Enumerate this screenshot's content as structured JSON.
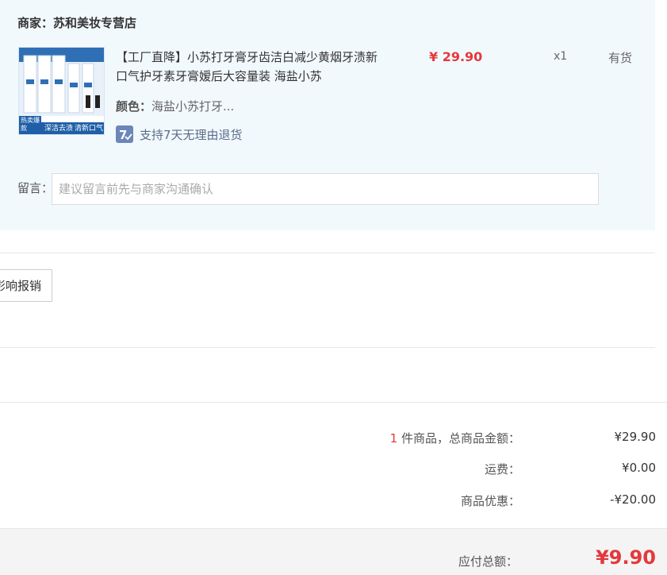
{
  "merchant": {
    "label": "商家：",
    "name": "苏和美妆专营店"
  },
  "product": {
    "title": "【工厂直降】小苏打牙膏牙齿洁白减少黄烟牙渍新口气护牙素牙膏嫒后大容量装 海盐小苏",
    "price": "¥ 29.90",
    "quantity": "x1",
    "stock": "有货",
    "attr_label": "颜色：",
    "attr_value": "海盐小苏打牙...",
    "return_policy": "支持7天无理由退货",
    "thumb_badge": "热卖爆款",
    "thumb_tag_left": "深洁去渍",
    "thumb_tag_right": "清新口气"
  },
  "note": {
    "label": "留言：",
    "placeholder": "建议留言前先与商家沟通确认"
  },
  "invoice": {
    "button_label": "影响报销"
  },
  "summary": {
    "count": "1",
    "items_label": " 件商品，总商品金额：",
    "items_amount": "¥29.90",
    "shipping_label": "运费：",
    "shipping_amount": "¥0.00",
    "discount_label": "商品优惠：",
    "discount_amount": "-¥20.00",
    "total_label": "应付总额：",
    "total_amount": "¥9.90"
  },
  "colors": {
    "accent_red": "#e4393c",
    "block_bg": "#f2f9fd",
    "return_icon_bg": "#6b86b8"
  }
}
